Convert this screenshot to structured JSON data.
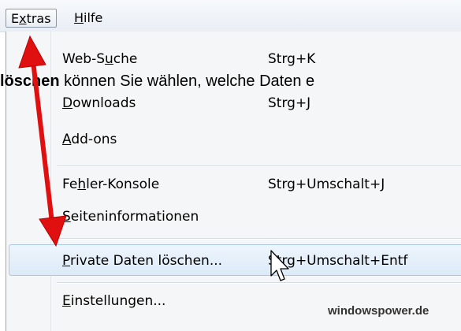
{
  "menubar": {
    "extras": {
      "pre": "E",
      "key": "x",
      "post": "tras"
    },
    "hilfe": {
      "pre": "",
      "key": "H",
      "post": "ilfe"
    }
  },
  "background_text": {
    "bold": "löschen",
    "rest": " können Sie wählen, welche Daten e"
  },
  "menu": {
    "websuche": {
      "pre": "Web-S",
      "key": "u",
      "post": "che",
      "shortcut": "Strg+K"
    },
    "downloads": {
      "pre": "",
      "key": "D",
      "post": "ownloads",
      "shortcut": "Strg+J"
    },
    "addons": {
      "pre": "",
      "key": "A",
      "post": "dd-ons"
    },
    "fehler": {
      "pre": "Fe",
      "key": "h",
      "post": "ler-Konsole",
      "shortcut": "Strg+Umschalt+J"
    },
    "seiteninfo": {
      "pre": "",
      "key": "S",
      "post": "eiteninformationen"
    },
    "private": {
      "pre": "",
      "key": "P",
      "post": "rivate Daten löschen...",
      "shortcut": "Strg+Umschalt+Entf"
    },
    "einstellungen": {
      "pre": "",
      "key": "E",
      "post": "instellungen..."
    }
  },
  "watermark": "windowspower.de",
  "colors": {
    "arrow": "#e01010",
    "highlight": "#dceaf8",
    "menu_bg": "#f5f6f7"
  },
  "icons": {
    "cursor": "mouse-pointer-icon",
    "arrow": "double-headed-arrow"
  }
}
